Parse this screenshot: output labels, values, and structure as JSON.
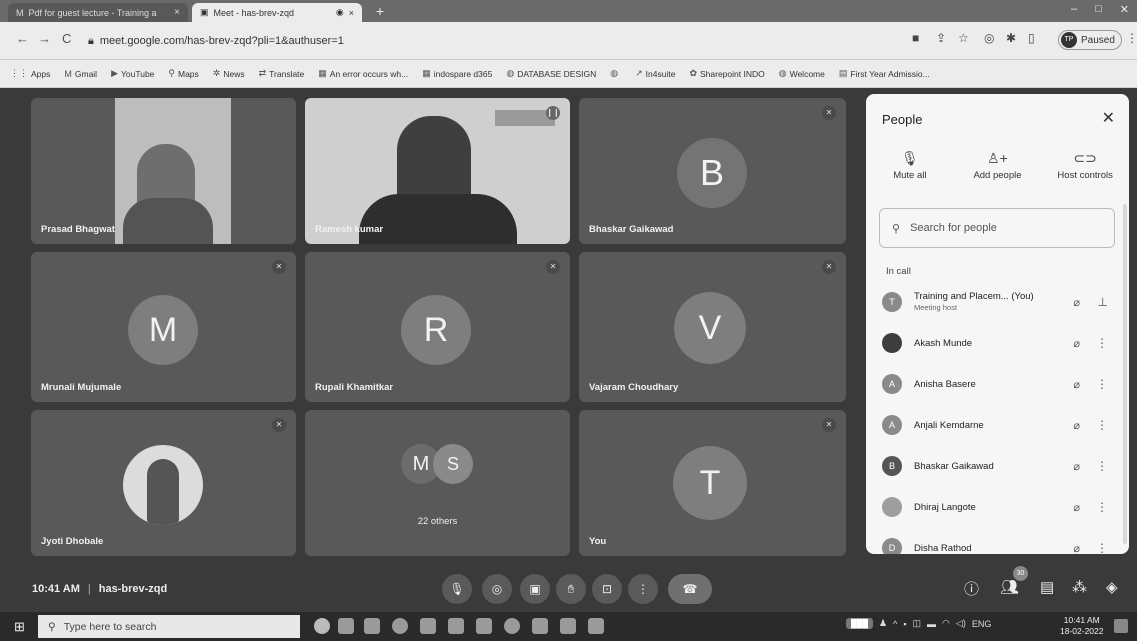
{
  "browser": {
    "tabs": [
      {
        "label": "Pdf for guest lecture - Training a",
        "icon": "gmail-icon"
      },
      {
        "label": "Meet - has-brev-zqd",
        "icon": "meet-icon"
      }
    ],
    "url": "meet.google.com/has-brev-zqd?pli=1&authuser=1",
    "profile_initials": "TP",
    "profile_status": "Paused",
    "bookmarks": [
      {
        "label": "Apps",
        "icon": "apps-grid-icon"
      },
      {
        "label": "Gmail",
        "icon": "gmail-icon"
      },
      {
        "label": "YouTube",
        "icon": "youtube-icon"
      },
      {
        "label": "Maps",
        "icon": "maps-pin-icon"
      },
      {
        "label": "News",
        "icon": "news-icon"
      },
      {
        "label": "Translate",
        "icon": "translate-icon"
      },
      {
        "label": "An error occurs wh...",
        "icon": "ms-grid-icon"
      },
      {
        "label": "indospare d365",
        "icon": "ms-grid-icon"
      },
      {
        "label": "DATABASE DESIGN",
        "icon": "globe-icon"
      },
      {
        "label": "",
        "icon": "globe-icon"
      },
      {
        "label": "In4suite",
        "icon": "arrow-icon"
      },
      {
        "label": "Sharepoint INDO",
        "icon": "sharepoint-icon"
      },
      {
        "label": "Welcome",
        "icon": "globe-icon"
      },
      {
        "label": "First Year Admissio...",
        "icon": "folder-icon"
      }
    ]
  },
  "tiles": [
    {
      "name": "Prasad Bhagwat",
      "type": "video"
    },
    {
      "name": "Ramesh kumar",
      "type": "video"
    },
    {
      "name": "Bhaskar Gaikawad",
      "initial": "B"
    },
    {
      "name": "Mrunali Mujumale",
      "initial": "M"
    },
    {
      "name": "Rupali Khamitkar",
      "initial": "R"
    },
    {
      "name": "Vajaram Choudhary",
      "initial": "V"
    },
    {
      "name": "Jyoti Dhobale",
      "type": "photo"
    },
    {
      "name": "22 others",
      "initials": [
        "M",
        "S"
      ]
    },
    {
      "name": "You",
      "initial": "T"
    }
  ],
  "people_panel": {
    "title": "People",
    "actions": [
      {
        "label": "Mute all",
        "icon": "mic-off-icon"
      },
      {
        "label": "Add people",
        "icon": "add-person-icon"
      },
      {
        "label": "Host controls",
        "icon": "toggle-icon"
      }
    ],
    "search_placeholder": "Search for people",
    "section_label": "In call",
    "participants": [
      {
        "name": "Training and Placem... (You)",
        "sub": "Meeting host",
        "initial": "T"
      },
      {
        "name": "Akash Munde",
        "initial": ""
      },
      {
        "name": "Anisha Basere",
        "initial": "A"
      },
      {
        "name": "Anjali Kemdarne",
        "initial": "A"
      },
      {
        "name": "Bhaskar Gaikawad",
        "initial": "B"
      },
      {
        "name": "Dhiraj Langote",
        "initial": ""
      },
      {
        "name": "Disha Rathod",
        "initial": "D"
      }
    ]
  },
  "meeting": {
    "time": "10:41 AM",
    "code": "has-brev-zqd",
    "participant_count": "30"
  },
  "taskbar": {
    "search_placeholder": "Type here to search",
    "tray_label": "ENG",
    "time": "10:41 AM",
    "date": "18-02-2022"
  }
}
